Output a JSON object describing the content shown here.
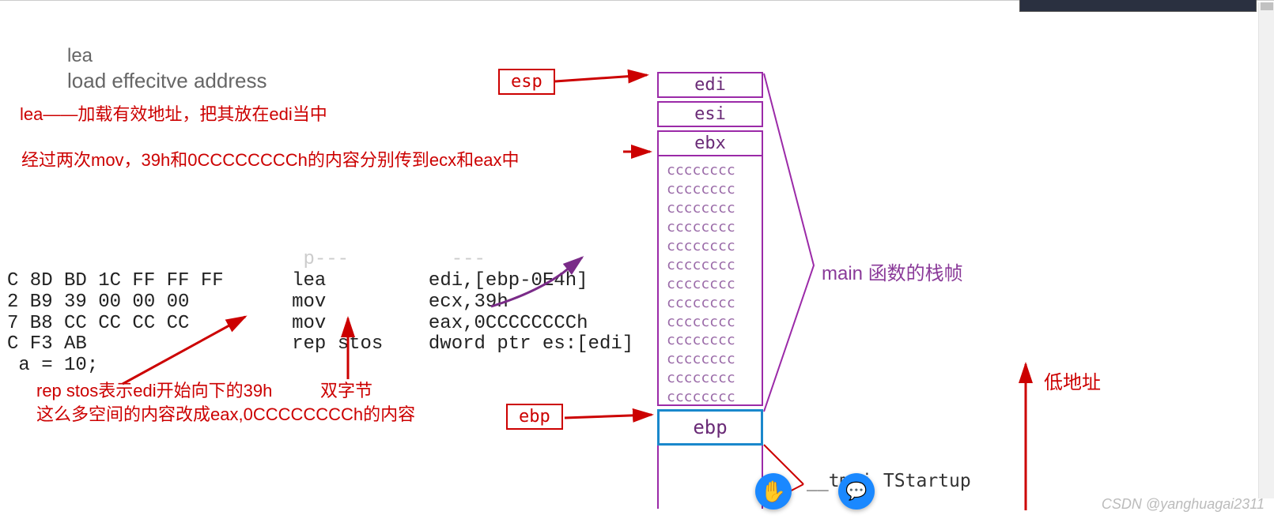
{
  "titles": {
    "lea": "lea",
    "lea_full": "load effecitve address"
  },
  "annotations": {
    "lea_cn": "lea——加载有效地址，把其放在edi当中",
    "mov_cn": "经过两次mov，39h和0CCCCCCCCh的内容分别传到ecx和eax中",
    "rep_stos_line1": "rep stos表示edi开始向下的39h",
    "rep_stos_line2": "这么多空间的内容改成eax,0CCCCCCCCh的内容",
    "double_byte": "双字节",
    "low_addr": "低地址"
  },
  "code": {
    "partial_top": "                          p---         ---",
    "l1_hex": "C 8D BD 1C FF FF FF",
    "l1_op": "lea",
    "l1_arg": "edi,[ebp-0E4h]",
    "l2_hex": "2 B9 39 00 00 00",
    "l2_op": "mov",
    "l2_arg": "ecx,39h",
    "l3_hex": "7 B8 CC CC CC CC",
    "l3_op": "mov",
    "l3_arg": "eax,0CCCCCCCCh",
    "l4_hex": "C F3 AB",
    "l4_op": "rep stos",
    "l4_arg": "dword ptr es:[edi]",
    "src": " a = 10;"
  },
  "ptr": {
    "esp": "esp",
    "ebp": "ebp"
  },
  "stack": {
    "r0": "edi",
    "r1": "esi",
    "r2": "ebx",
    "cc_line": "cccccccc",
    "cc_count": 13,
    "ebpcell": "ebp"
  },
  "diagram": {
    "main_frame": "main 函数的栈帧",
    "tmain": "__tmai      TStartup"
  },
  "watermark": "CSDN @yanghuagai2311",
  "icons": {
    "hand": "✋",
    "chat": "💬"
  }
}
